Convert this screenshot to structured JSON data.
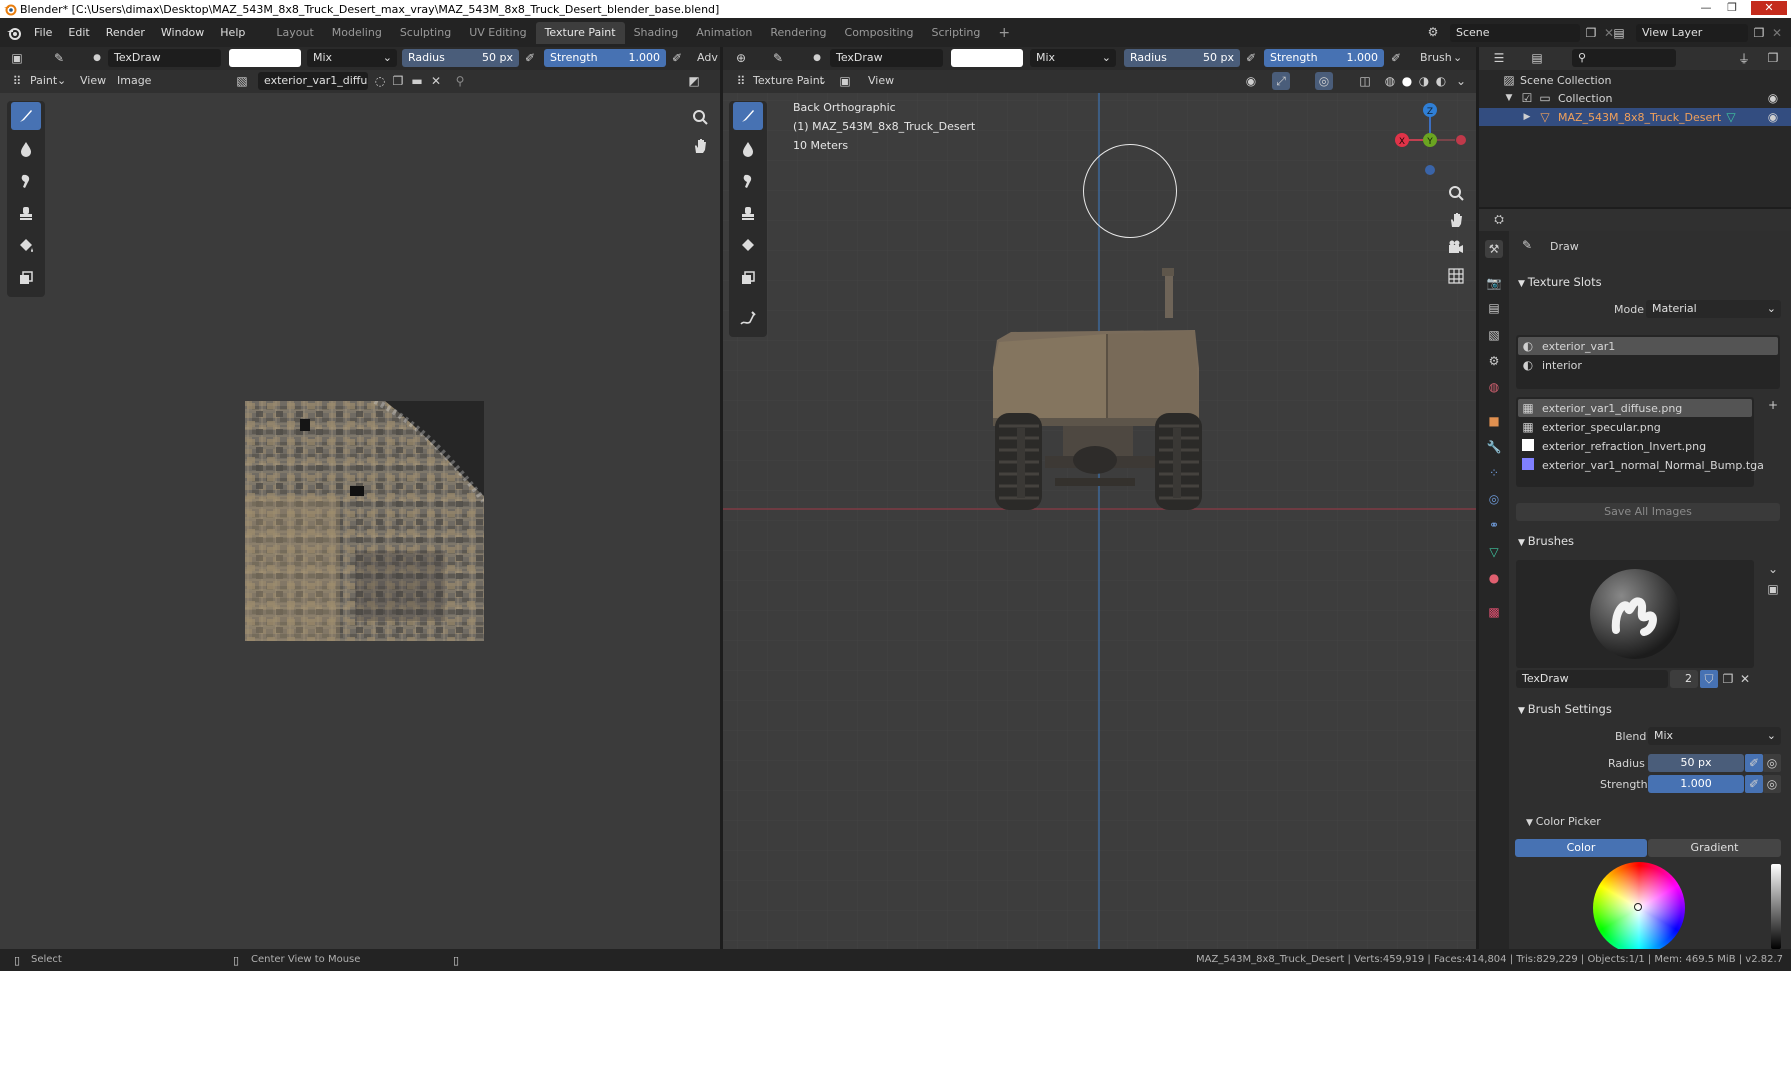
{
  "window": {
    "title": "Blender* [C:\\Users\\dimax\\Desktop\\MAZ_543M_8x8_Truck_Desert_max_vray\\MAZ_543M_8x8_Truck_Desert_blender_base.blend]",
    "minimize": "—",
    "maximize": "❐",
    "close": "✕"
  },
  "menu": [
    "File",
    "Edit",
    "Render",
    "Window",
    "Help"
  ],
  "workspaces": [
    "Layout",
    "Modeling",
    "Sculpting",
    "UV Editing",
    "Texture Paint",
    "Shading",
    "Animation",
    "Rendering",
    "Compositing",
    "Scripting"
  ],
  "active_workspace": "Texture Paint",
  "top_right": {
    "scene": "Scene",
    "view_layer": "View Layer"
  },
  "image_editor": {
    "brush_name": "TexDraw",
    "blend": "Mix",
    "radius_label": "Radius",
    "radius_value": "50 px",
    "strength_label": "Strength",
    "strength_value": "1.000",
    "overflow": "Adv",
    "mode": "Paint",
    "view_menu": "View",
    "image_menu": "Image",
    "image_name": "exterior_var1_diffus.."
  },
  "viewport": {
    "brush_name": "TexDraw",
    "blend": "Mix",
    "radius_label": "Radius",
    "radius_value": "50 px",
    "strength_label": "Strength",
    "strength_value": "1.000",
    "brush_menu": "Brush",
    "mode": "Texture Paint",
    "view_menu": "View",
    "overlay_line1": "Back Orthographic",
    "overlay_line2": "(1) MAZ_543M_8x8_Truck_Desert",
    "overlay_line3": "10 Meters",
    "gizmo": {
      "x": "X",
      "y": "Y",
      "z": "Z"
    }
  },
  "outliner": {
    "scene_collection": "Scene Collection",
    "collection": "Collection",
    "object": "MAZ_543M_8x8_Truck_Desert"
  },
  "properties": {
    "tool_name": "Draw",
    "texture_slots_header": "Texture Slots",
    "mode_label": "Mode",
    "mode_value": "Material",
    "materials": [
      "exterior_var1",
      "interior"
    ],
    "images": [
      "exterior_var1_diffuse.png",
      "exterior_specular.png",
      "exterior_refraction_Invert.png",
      "exterior_var1_normal_Normal_Bump.tga"
    ],
    "save_all": "Save All Images",
    "brushes_header": "Brushes",
    "brush_name": "TexDraw",
    "brush_users": "2",
    "brush_settings_header": "Brush Settings",
    "blend_label": "Blend",
    "blend_value": "Mix",
    "radius_label": "Radius",
    "radius_value": "50 px",
    "strength_label": "Strength",
    "strength_value": "1.000",
    "color_picker_header": "Color Picker",
    "color_tab": "Color",
    "gradient_tab": "Gradient"
  },
  "status": {
    "left": "Select",
    "middle": "Center View to Mouse",
    "stats": "MAZ_543M_8x8_Truck_Desert | Verts:459,919 | Faces:414,804 | Tris:829,229 | Objects:1/1 | Mem: 469.5 MiB | v2.82.7"
  },
  "colors": {
    "accent": "#4772b3",
    "selected_object": "#f0a05a",
    "background": "#303030",
    "header": "#2a2a2a"
  },
  "icons": [
    "blender-logo-icon",
    "brush-icon",
    "soften-icon",
    "smear-icon",
    "clone-icon",
    "fill-icon",
    "mask-icon",
    "annotate-icon",
    "zoom-icon",
    "hand-icon",
    "camera-icon",
    "grid-icon",
    "eye-icon",
    "search-icon",
    "filter-icon",
    "wrench-icon"
  ]
}
